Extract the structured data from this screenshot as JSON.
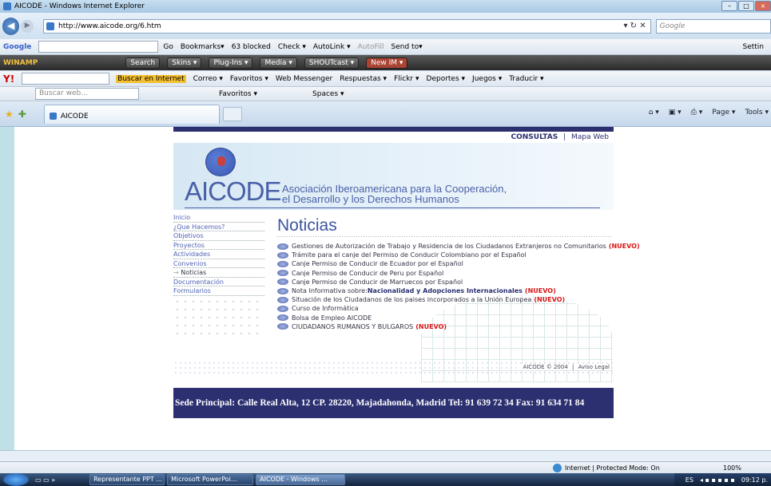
{
  "window": {
    "title": "AICODE - Windows Internet Explorer"
  },
  "address": {
    "url": "http://www.aicode.org/6.htm",
    "search_placeholder": "Google"
  },
  "toolbar_google": {
    "label": "Google",
    "items": [
      "Go",
      "Bookmarks▾",
      "63 blocked",
      "Check ▾",
      "AutoLink ▾",
      "AutoFill",
      "Send to▾"
    ],
    "settings": "Settin"
  },
  "toolbar_winamp": {
    "logo": "WINAMP",
    "search": "Search",
    "items": [
      "Skins ▾",
      "Plug-Ins ▾",
      "Media ▾",
      "SHOUTcast ▾",
      "New IM ▾"
    ]
  },
  "toolbar_yahoo": {
    "items": [
      "Buscar en Internet",
      "Correo ▾",
      "Favoritos ▾",
      "Web Messenger",
      "Respuestas ▾",
      "Flickr ▾",
      "Deportes ▾",
      "Juegos ▾",
      "Traducir ▾"
    ]
  },
  "toolbar_live": {
    "search_placeholder": "Buscar web...",
    "items": [
      "Favoritos ▾",
      "Spaces ▾"
    ]
  },
  "tab": {
    "label": "AICODE"
  },
  "commands": {
    "page": "Page ▾",
    "tools": "Tools ▾"
  },
  "site": {
    "topnav": {
      "consultas": "CONSULTAS",
      "sep": "|",
      "mapa": "Mapa Web"
    },
    "logo": "AICODE",
    "assoc_line1": "Asociación Iberoamericana para la Cooperación,",
    "assoc_line2": "el Desarrollo y los Derechos Humanos",
    "menu": [
      "Inicio",
      "¿Que Hacemos?",
      "Objetivos",
      "Proyectos",
      "Actividades",
      "Convenios",
      "Noticias",
      "Documentación",
      "Formularios"
    ],
    "heading": "Noticias",
    "news": [
      {
        "text": "Gestiones de Autorización de Trabajo y Residencia de los Ciudadanos Extranjeros no Comunitarios",
        "bold": "",
        "tag": "(NUEVO)"
      },
      {
        "text": "Trámite para el canje del Permiso de Conducir Colombiano por el Español",
        "bold": "",
        "tag": ""
      },
      {
        "text": "Canje Permiso de Conducir de Ecuador por el Español",
        "bold": "",
        "tag": ""
      },
      {
        "text": "Canje Permiso de Conducir de Peru por Español",
        "bold": "",
        "tag": ""
      },
      {
        "text": "Canje Permiso de Conducir de Marruecos por Español",
        "bold": "",
        "tag": ""
      },
      {
        "text": "Nota Informativa sobre: ",
        "bold": "Nacionalidad y Adopciones Internacionales",
        "tag": "(NUEVO)"
      },
      {
        "text": "Situación de los Ciudadanos de los paises incorporados a la Unión Europea",
        "bold": "",
        "tag": "(NUEVO)"
      },
      {
        "text": "Curso de Informática",
        "bold": "",
        "tag": ""
      },
      {
        "text": "Bolsa de Empleo AICODE",
        "bold": "",
        "tag": ""
      },
      {
        "text": "CIUDADANOS RUMANOS Y BULGAROS",
        "bold": "",
        "tag": "(NUEVO)"
      }
    ],
    "footer_copy": "AICODE © 2004",
    "footer_sep": "|",
    "footer_legal": "Aviso Legal",
    "address_bar": "Sede Principal: Calle Real Alta, 12 CP. 28220, Majadahonda, Madrid Tel: 91 639 72 34 Fax: 91 634 71 84"
  },
  "status": {
    "zone": "Internet | Protected Mode: On",
    "zoom": "100%"
  },
  "taskbar": {
    "items": [
      "Representante PPT ...",
      "Microsoft PowerPoi...",
      "AICODE - Windows ..."
    ],
    "lang": "ES",
    "time": "09:12 p."
  }
}
